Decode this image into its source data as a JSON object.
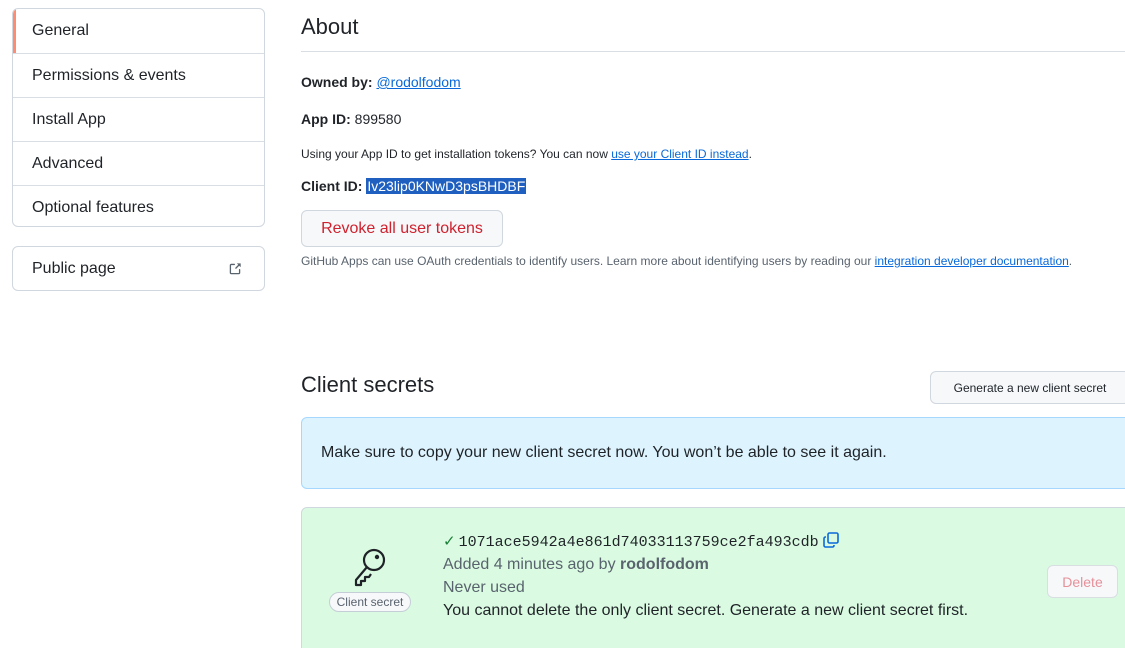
{
  "sidebar": {
    "items": [
      {
        "label": "General",
        "selected": true
      },
      {
        "label": "Permissions & events"
      },
      {
        "label": "Install App"
      },
      {
        "label": "Advanced"
      },
      {
        "label": "Optional features"
      }
    ],
    "public_page": {
      "label": "Public page",
      "icon": "external-link-icon"
    }
  },
  "about": {
    "title": "About",
    "owned_by_label": "Owned by:",
    "owner": "@rodolfodom",
    "app_id_label": "App ID:",
    "app_id": "899580",
    "client_id_hint_prefix": "Using your App ID to get installation tokens? You can now ",
    "client_id_hint_link": "use your Client ID instead",
    "client_id_hint_suffix": ".",
    "client_id_label": "Client ID:",
    "client_id": "Iv23lip0KNwD3psBHDBF",
    "revoke_button": "Revoke all user tokens",
    "oauth_note_prefix": "GitHub Apps can use OAuth credentials to identify users. Learn more about identifying users by reading our ",
    "oauth_note_link": "integration developer documentation",
    "oauth_note_suffix": "."
  },
  "secrets": {
    "title": "Client secrets",
    "generate_button": "Generate a new client secret",
    "flash_message": "Make sure to copy your new client secret now. You won’t be able to see it again.",
    "secret": {
      "icon": "key-icon",
      "label": "Client secret",
      "check": "✓",
      "value": "1071ace5942a4e861d74033113759ce2fa493cdb",
      "added_prefix": "Added 4 minutes ago by ",
      "added_by": "rodolfodom",
      "usage": "Never used",
      "warning": "You cannot delete the only client secret. Generate a new client secret first.",
      "delete_button": "Delete"
    }
  },
  "colors": {
    "accent": "#0969da",
    "danger": "#cf222e",
    "flash_bg": "#ddf4ff",
    "success_bg": "#dafbe1",
    "selected_marker": "#fd8c73"
  }
}
